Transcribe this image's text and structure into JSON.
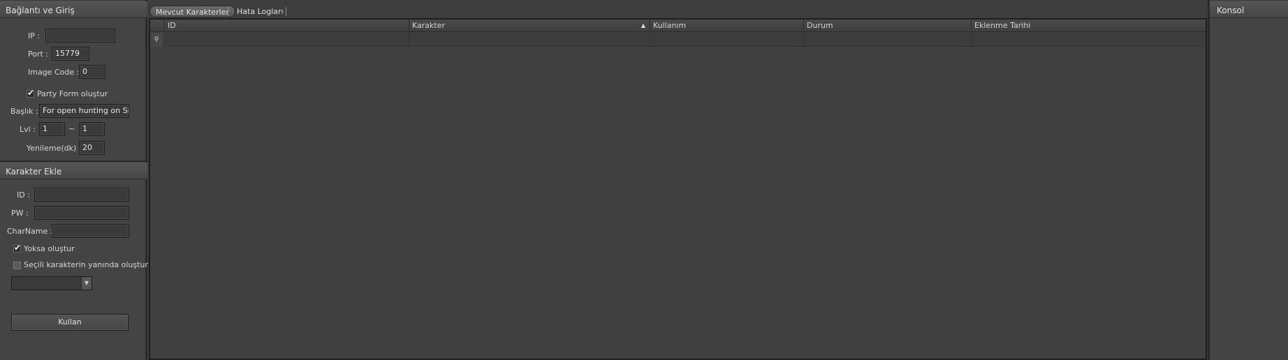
{
  "connection": {
    "title": "Bağlantı ve Giriş",
    "ip_label": "IP :",
    "ip_value": "",
    "port_label": "Port :",
    "port_value": "15779",
    "image_code_label": "Image Code :",
    "image_code_value": "0",
    "party_form_label": "Party Form oluştur",
    "party_form_checked": true,
    "title_label": "Başlık :",
    "title_value": "For open hunting on Silkr",
    "lvl_label": "Lvl :",
    "lvl_min": "1",
    "lvl_sep": "~",
    "lvl_max": "1",
    "refresh_label": "Yenileme(dk) :",
    "refresh_value": "20"
  },
  "add_character": {
    "title": "Karakter Ekle",
    "id_label": "ID :",
    "id_value": "",
    "pw_label": "PW :",
    "pw_value": "",
    "charname_label": "CharName :",
    "charname_value": "",
    "create_if_missing_label": "Yoksa oluştur",
    "create_if_missing_checked": true,
    "create_near_selected_label": "Seçili karakterin yanında oluştur",
    "create_near_selected_checked": false,
    "dropdown_value": "",
    "use_button": "Kullan"
  },
  "tabs": [
    {
      "label": "Mevcut Karakterler",
      "active": true
    },
    {
      "label": "Hata Logları",
      "active": false
    }
  ],
  "grid": {
    "columns": [
      "ID",
      "Karakter",
      "Kullanım",
      "Durum",
      "Eklenme Tarihi"
    ],
    "sorted_column": "Karakter",
    "sort_direction": "ascending",
    "rows": []
  },
  "console": {
    "title": "Konsol"
  }
}
